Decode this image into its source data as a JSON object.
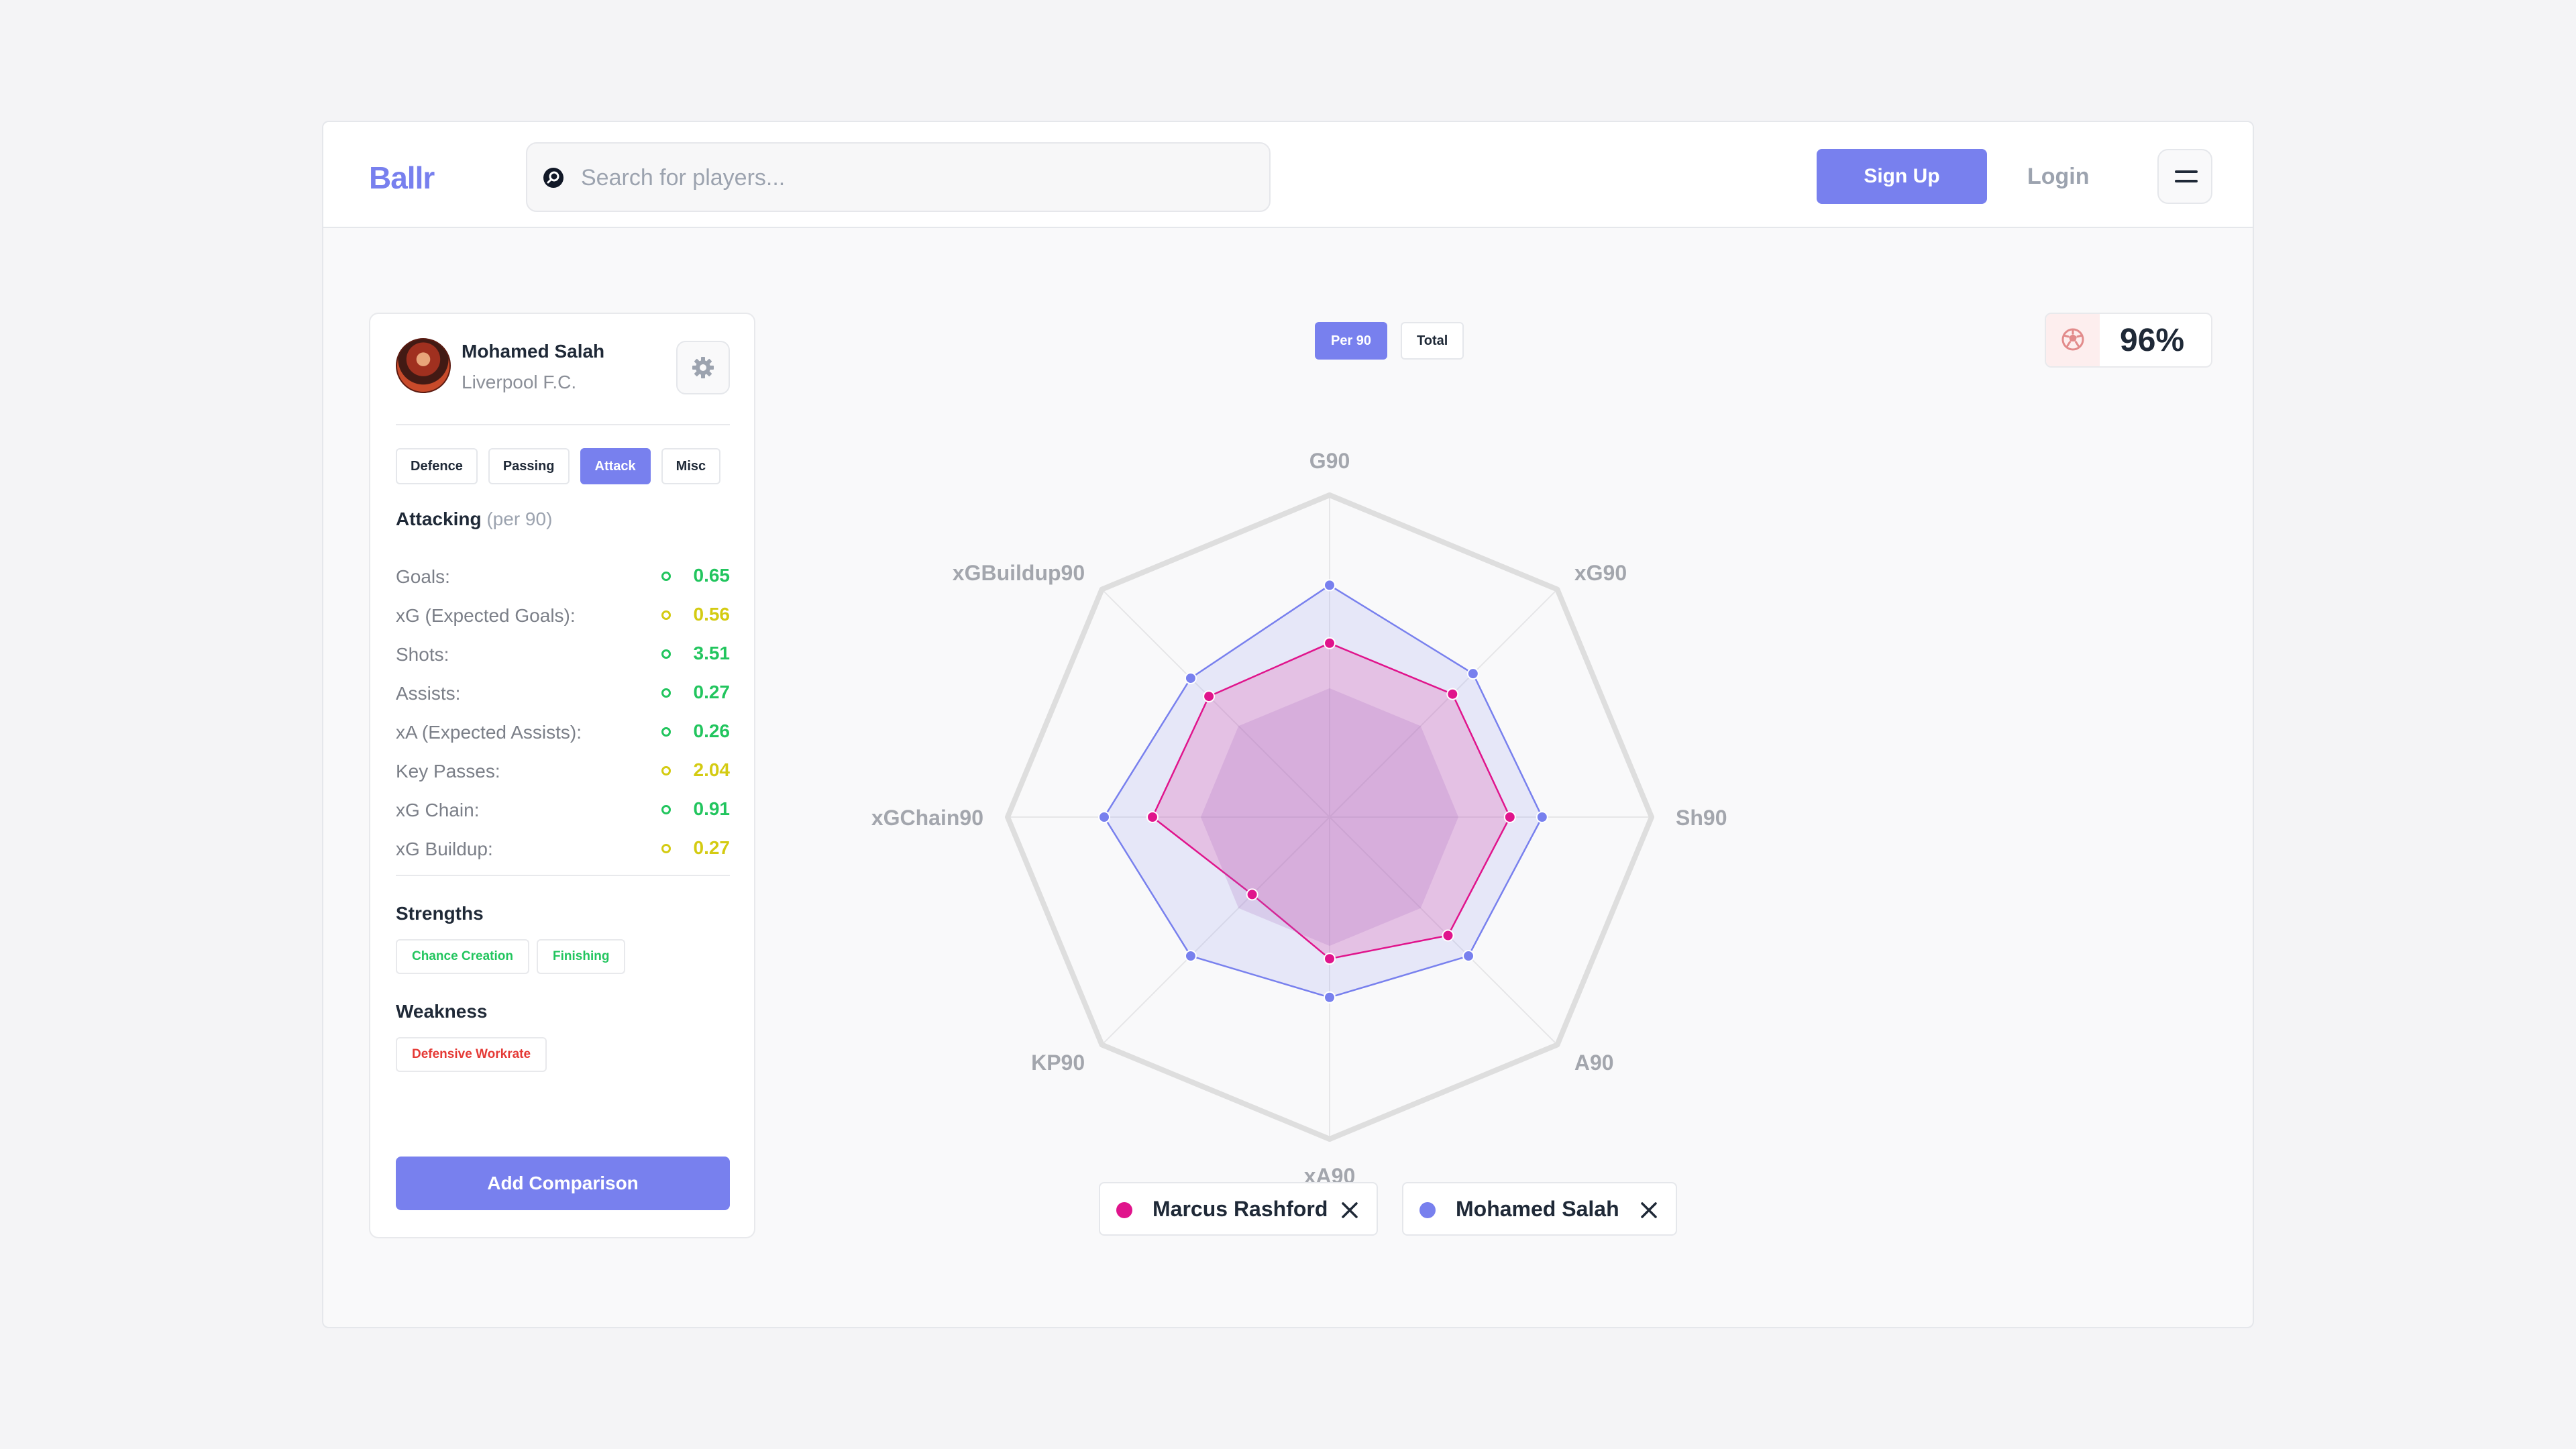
{
  "app": {
    "logo": "Ballr"
  },
  "search": {
    "placeholder": "Search for players..."
  },
  "nav": {
    "signup": "Sign Up",
    "login": "Login"
  },
  "player": {
    "name": "Mohamed Salah",
    "club": "Liverpool F.C."
  },
  "tabs": [
    {
      "label": "Defence",
      "active": false
    },
    {
      "label": "Passing",
      "active": false
    },
    {
      "label": "Attack",
      "active": true
    },
    {
      "label": "Misc",
      "active": false
    }
  ],
  "section": {
    "title": "Attacking",
    "subtitle": "(per 90)"
  },
  "stats": [
    {
      "label": "Goals:",
      "value": "0.65",
      "color": "#22c55e"
    },
    {
      "label": "xG (Expected Goals):",
      "value": "0.56",
      "color": "#d4cb12"
    },
    {
      "label": "Shots:",
      "value": "3.51",
      "color": "#22c55e"
    },
    {
      "label": "Assists:",
      "value": "0.27",
      "color": "#22c55e"
    },
    {
      "label": "xA (Expected Assists):",
      "value": "0.26",
      "color": "#22c55e"
    },
    {
      "label": "Key Passes:",
      "value": "2.04",
      "color": "#d4cb12"
    },
    {
      "label": "xG Chain:",
      "value": "0.91",
      "color": "#22c55e"
    },
    {
      "label": "xG Buildup:",
      "value": "0.27",
      "color": "#d4cb12"
    }
  ],
  "strengths": {
    "title": "Strengths",
    "tags": [
      "Chance Creation",
      "Finishing"
    ]
  },
  "weakness": {
    "title": "Weakness",
    "tags": [
      "Defensive Workrate"
    ]
  },
  "add_comparison": "Add Comparison",
  "mode_toggle": {
    "per90": "Per 90",
    "total": "Total",
    "active": "per90"
  },
  "score": {
    "value": "96%"
  },
  "legend": [
    {
      "name": "Marcus Rashford",
      "color": "#e0148c"
    },
    {
      "name": "Mohamed Salah",
      "color": "#7880ee"
    }
  ],
  "colors": {
    "accent": "#7880ee",
    "rashford": "#e0148c",
    "salah": "#7880ee",
    "good": "#22c55e",
    "avg": "#d4cb12",
    "bad": "#e53935"
  },
  "chart_data": {
    "type": "radar",
    "axes": [
      "G90",
      "xG90",
      "Sh90",
      "A90",
      "xA90",
      "KP90",
      "xGChain90",
      "xGBuildup90"
    ],
    "range": [
      0,
      1
    ],
    "series": [
      {
        "name": "Marcus Rashford",
        "values": [
          0.54,
          0.54,
          0.56,
          0.52,
          0.44,
          0.34,
          0.55,
          0.53
        ]
      },
      {
        "name": "Mohamed Salah",
        "values": [
          0.72,
          0.63,
          0.66,
          0.61,
          0.56,
          0.61,
          0.7,
          0.61
        ]
      },
      {
        "name": "",
        "values": [
          0.4,
          0.4,
          0.4,
          0.4,
          0.4,
          0.4,
          0.4,
          0.4
        ]
      }
    ]
  }
}
